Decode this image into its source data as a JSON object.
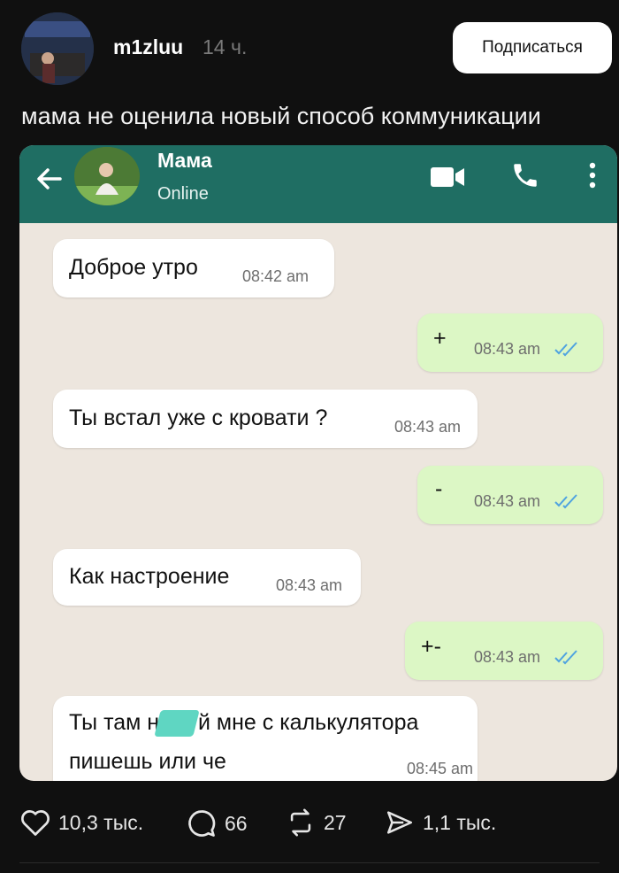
{
  "post": {
    "username": "m1zluu",
    "time": "14 ч.",
    "follow_label": "Подписаться",
    "text": "мама не оценила новый способ коммуникации"
  },
  "chat": {
    "contact_name": "Мама",
    "status": "Online",
    "messages": [
      {
        "dir": "in",
        "text": "Доброе утро",
        "time": "08:42 am"
      },
      {
        "dir": "out",
        "text": "+",
        "time": "08:43 am"
      },
      {
        "dir": "in",
        "text": "Ты встал уже с кровати ?",
        "time": "08:43 am"
      },
      {
        "dir": "out",
        "text": "-",
        "time": "08:43 am"
      },
      {
        "dir": "in",
        "text": "Как настроение",
        "time": "08:43 am"
      },
      {
        "dir": "out",
        "text": "+-",
        "time": "08:43 am"
      },
      {
        "dir": "in",
        "text": "Ты там н",
        "text2": "й мне с калькулятора",
        "text3": "пишешь или че",
        "time": "08:45 am"
      }
    ],
    "colors": {
      "header": "#1f6e63",
      "background": "#ede6de",
      "outgoing": "#dcf7c5",
      "incoming": "#ffffff",
      "ticks": "#4fa3e0",
      "censor": "#5fd6c2"
    }
  },
  "actions": {
    "likes": "10,3 тыс.",
    "comments": "66",
    "reposts": "27",
    "shares": "1,1 тыс."
  }
}
